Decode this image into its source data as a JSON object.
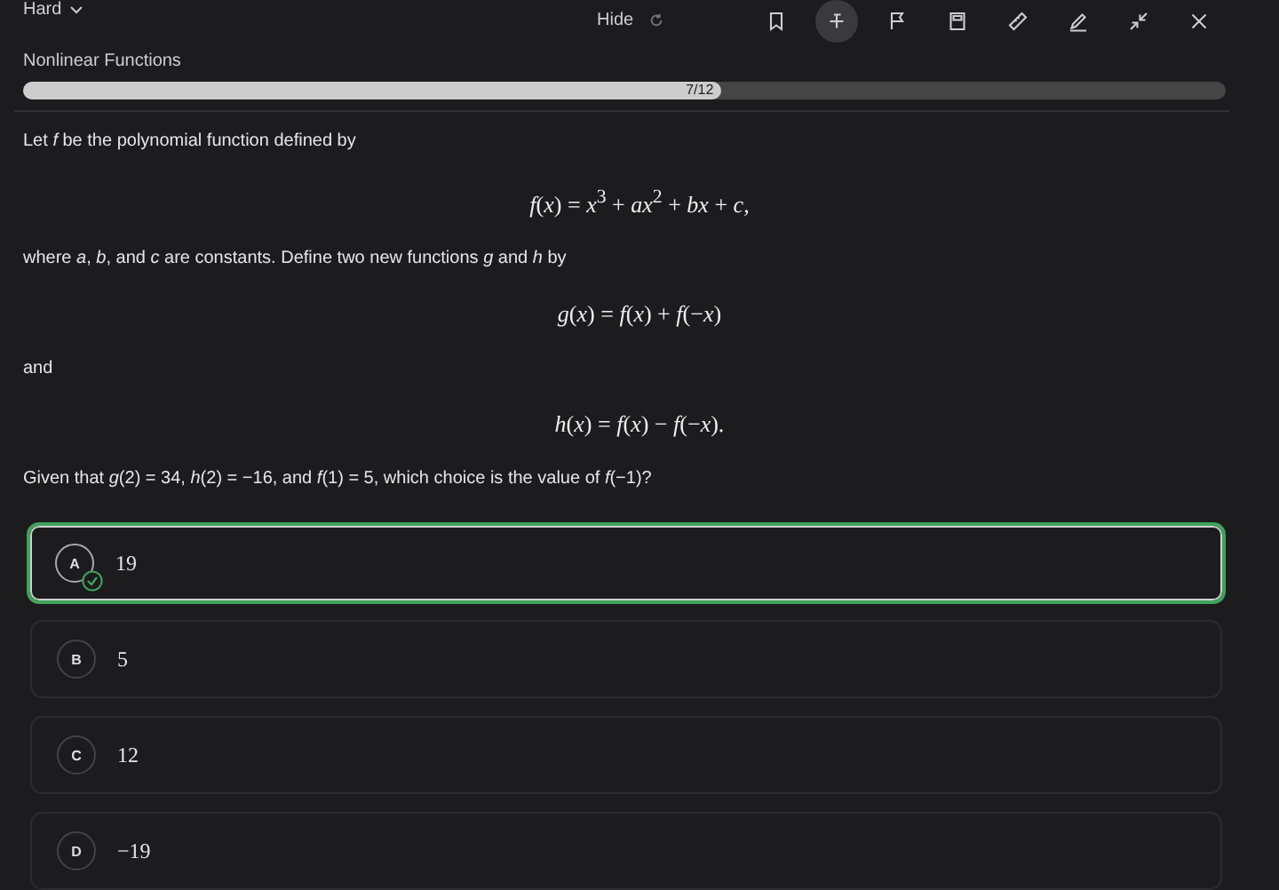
{
  "difficulty": {
    "label": "Hard"
  },
  "hide_button": {
    "label": "Hide"
  },
  "toolbar": [
    {
      "kind": "bookmark",
      "selected": false
    },
    {
      "kind": "strike",
      "selected": true
    },
    {
      "kind": "flag",
      "selected": false
    },
    {
      "kind": "calculator",
      "selected": false
    },
    {
      "kind": "ruler",
      "selected": false
    },
    {
      "kind": "pen",
      "selected": false
    },
    {
      "kind": "collapse",
      "selected": false
    },
    {
      "kind": "close",
      "selected": false
    }
  ],
  "topic": "Nonlinear Functions",
  "progress": {
    "label": "7/12",
    "level": 0.58
  },
  "question": [
    {
      "kind": "text",
      "text": "Let *f* be the polynomial function defined by"
    },
    {
      "kind": "equation",
      "text": "*f*(*x*) = *x*$^{3}$ + *ax*$^{2}$ + *bx* + *c*,"
    },
    {
      "kind": "text",
      "text": "where *a*, *b*, and *c* are constants. Define two new functions *g* and *h* by"
    },
    {
      "kind": "equation",
      "text": "*g*(*x*) = *f*(*x*) + *f*(−*x*)"
    },
    {
      "kind": "text",
      "text": "and"
    },
    {
      "kind": "equation",
      "text": "*h*(*x*) = *f*(*x*) − *f*(−*x*)."
    },
    {
      "kind": "text",
      "text": "Given that *g*(2) = 34, *h*(2) = −16, and *f*(1) = 5, which choice is the value of *f*(−1)?"
    }
  ],
  "choices": [
    {
      "letter": "A",
      "text": "19",
      "selected": true,
      "correct": true
    },
    {
      "letter": "B",
      "text": "5",
      "selected": false,
      "correct": false
    },
    {
      "letter": "C",
      "text": "12",
      "selected": false,
      "correct": false
    },
    {
      "letter": "D",
      "text": "−19",
      "selected": false,
      "correct": false
    }
  ]
}
